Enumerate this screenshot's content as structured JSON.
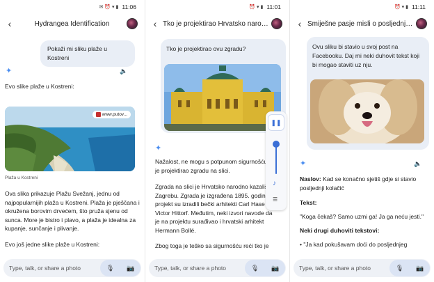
{
  "status_times": [
    "11:06",
    "11:01",
    "11:11"
  ],
  "input": {
    "placeholder": "Type, talk, or share a photo"
  },
  "screen1": {
    "title": "Hydrangea Identification",
    "user_message": "Pokaži mi sliku plaže u Kostreni",
    "reply_intro": "Evo slike plaže u Kostreni:",
    "image_source": "www.putov...",
    "image_caption": "Plaža u Kostreni",
    "paragraph1": "Ova slika prikazuje Plažu Svežanj, jednu od najpopularnijih plaža u Kostreni. Plaža je pješčana i okružena borovim drvećem, što pruža sjenu od sunca. More je bistro i plavo, a plaža je idealna za kupanje, sunčanje i plivanje.",
    "paragraph2": "Evo još jedne slike plaže u Kostreni:"
  },
  "screen2": {
    "title": "Tko je projektirao Hrvatsko narodn...",
    "user_message": "Tko je projektirao ovu zgradu?",
    "paragraph1": "Nažalost, ne mogu s potpunom sigurnošću tko je projektirao zgradu na slici.",
    "paragraph2": "Zgrada na slici je Hrvatsko narodno kazališ Zagrebu. Zgrada je izgrađena 1895. godine projekt su izradili bečki arhitekti Carl Hase i Victor Hittorf. Međutim, neki izvori navode da je na projektu surađivao i hrvatski arhitekt Hermann Bollé.",
    "paragraph3": "Zbog toga je teško sa sigurnošću reći tko je"
  },
  "screen3": {
    "title": "Smiješne pasje misli o posljednjem...",
    "user_message": "Ovu sliku bi stavio u svoj post na Facebooku. Daj mi neki duhovit tekst koji bi mogao staviti uz nju.",
    "naslov_label": "Naslov:",
    "naslov_text": " Kad se konačno sjetiš gdje si stavio posljednji kolačić",
    "tekst_label": "Tekst:",
    "tekst_quote": "\"Koga čekaš? Samo uzmi ga! Ja ga neću jesti.\"",
    "others_label": "Neki drugi duhoviti tekstovi:",
    "bullet1": "\"Ja kad pokušavam doći do posljednjeg"
  },
  "colors": {
    "accent": "#4a8df0",
    "bubble": "#e9eef6",
    "input_bg": "#eef1f6"
  }
}
